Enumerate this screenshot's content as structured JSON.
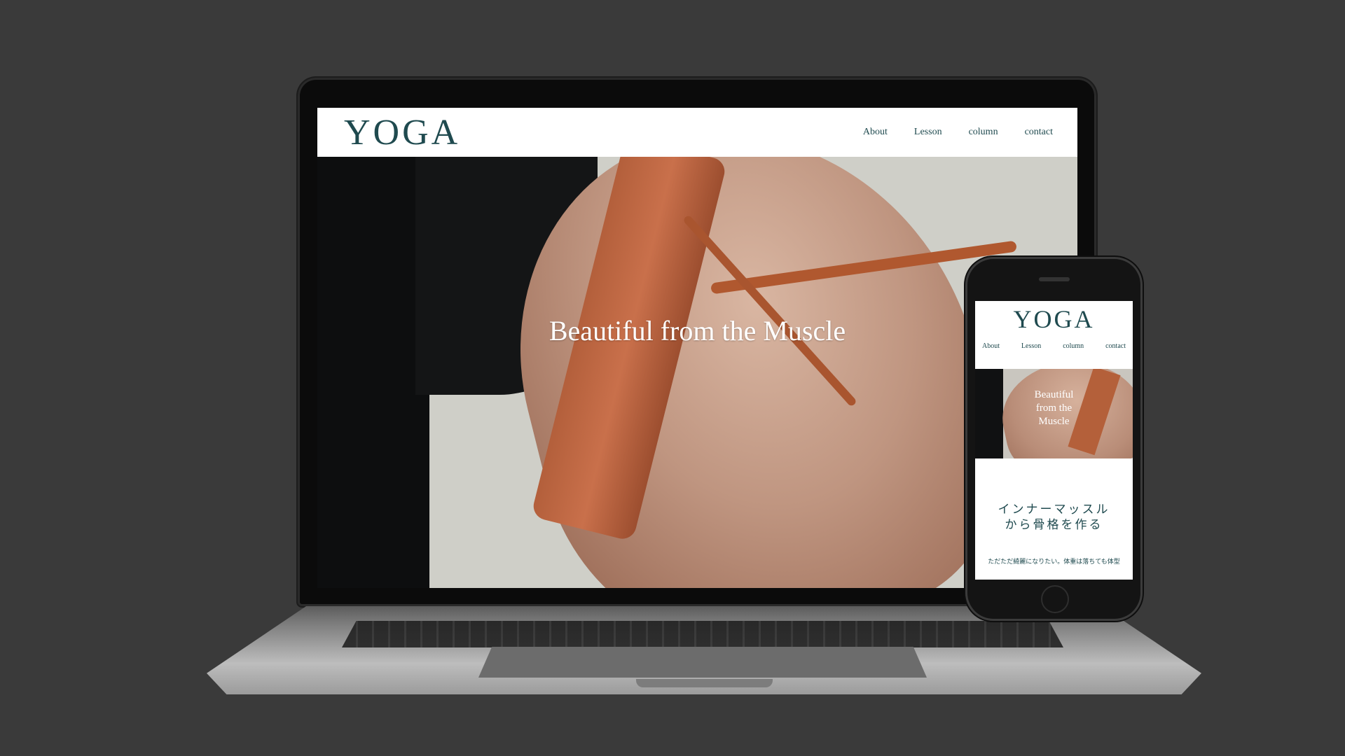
{
  "brand": {
    "logo": "YOGA",
    "color": "#1f4a4f"
  },
  "desktop": {
    "nav": [
      "About",
      "Lesson",
      "column",
      "contact"
    ],
    "hero_title": "Beautiful from the Muscle"
  },
  "mobile": {
    "logo": "YOGA",
    "nav": [
      "About",
      "Lesson",
      "column",
      "contact"
    ],
    "hero_title_lines": [
      "Beautiful",
      "from the",
      "Muscle"
    ],
    "section_heading_lines": [
      "インナーマッスル",
      "から骨格を作る"
    ],
    "section_body": "ただただ綺麗になりたい。体重は落ちても体型"
  }
}
